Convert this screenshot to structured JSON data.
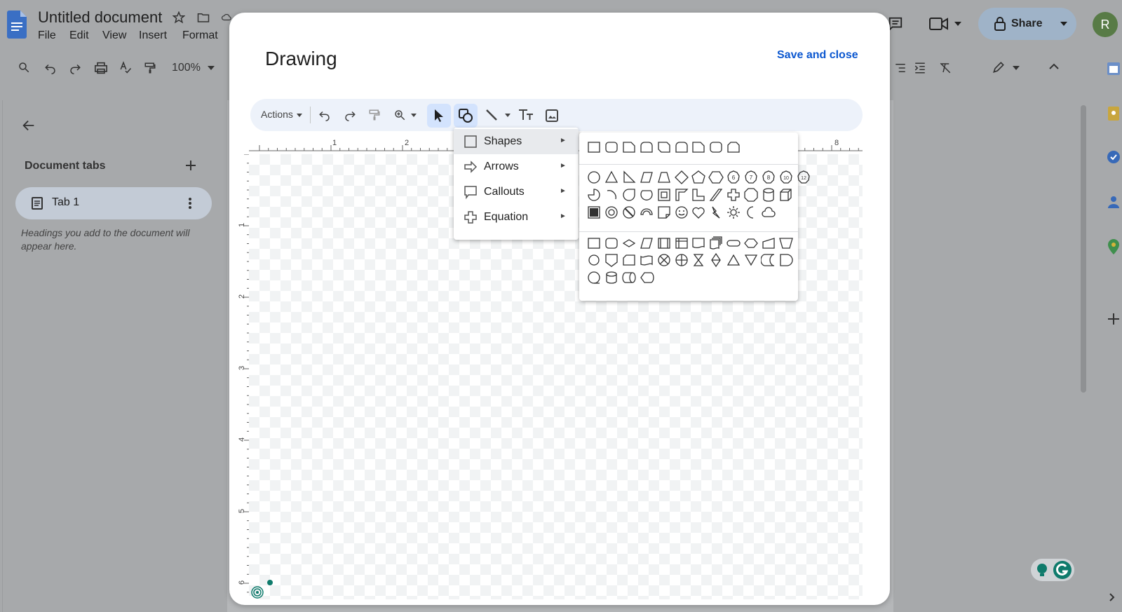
{
  "app": {
    "doc_title": "Untitled document",
    "menus": [
      "File",
      "Edit",
      "View",
      "Insert",
      "Format"
    ],
    "zoom": "100%",
    "share_label": "Share",
    "avatar_initial": "R"
  },
  "sidebar": {
    "tabs_title": "Document tabs",
    "tab_label": "Tab 1",
    "hint": "Headings you add to the document will appear here."
  },
  "drawing": {
    "title": "Drawing",
    "save_close": "Save and close",
    "actions_label": "Actions",
    "ruler_h_labels": [
      "1",
      "2",
      "8"
    ],
    "ruler_v_labels": [
      "1",
      "2",
      "3",
      "4",
      "5",
      "6"
    ]
  },
  "shape_menu": {
    "items": [
      {
        "label": "Shapes",
        "icon": "square-icon"
      },
      {
        "label": "Arrows",
        "icon": "arrow-icon"
      },
      {
        "label": "Callouts",
        "icon": "callout-icon"
      },
      {
        "label": "Equation",
        "icon": "plus-icon"
      }
    ],
    "submenu_arrow": "►",
    "badges": [
      "6",
      "7",
      "8",
      "10",
      "12"
    ]
  },
  "colors": {
    "accent": "#0b57d0",
    "selected_bg": "#d3e3fd",
    "toolbar_bg": "#edf2fa"
  }
}
